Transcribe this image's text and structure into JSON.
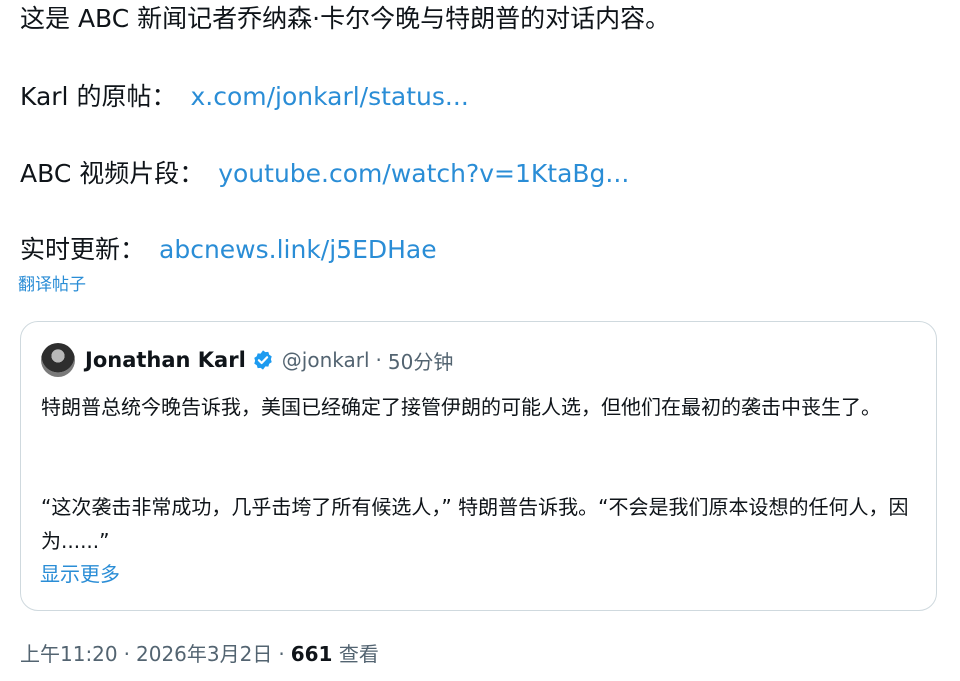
{
  "post": {
    "intro": "这是 ABC 新闻记者乔纳森·卡尔今晚与特朗普的对话内容。",
    "links": [
      {
        "label": "Karl 的原帖：",
        "url": "x.com/jonkarl/status..."
      },
      {
        "label": "ABC 视频片段：",
        "url": "youtube.com/watch?v=1KtaBg..."
      },
      {
        "label": "实时更新：",
        "url": "abcnews.link/j5EDHae"
      }
    ],
    "translate_label": "翻译帖子"
  },
  "quote": {
    "author_name": "Jonathan Karl",
    "author_handle": "@jonkarl",
    "separator": "·",
    "age": "50分钟",
    "paragraphs": [
      "特朗普总统今晚告诉我，美国已经确定了接管伊朗的可能人选，但他们在最初的袭击中丧生了。",
      "“这次袭击非常成功，几乎击垮了所有候选人，” 特朗普告诉我。“不会是我们原本设想的任何人，因为......”"
    ],
    "show_more": "显示更多"
  },
  "footer": {
    "time": "上午11:20",
    "sep": "·",
    "date": "2026年3月2日",
    "views": "661",
    "views_label": "查看"
  },
  "colors": {
    "link": "#2a8dd6",
    "text": "#0f1419",
    "muted": "#536471",
    "verified": "#1d9bf0",
    "border": "#cfd9de"
  },
  "icons": {
    "verified": "verified-badge-icon",
    "avatar": "author-avatar"
  }
}
